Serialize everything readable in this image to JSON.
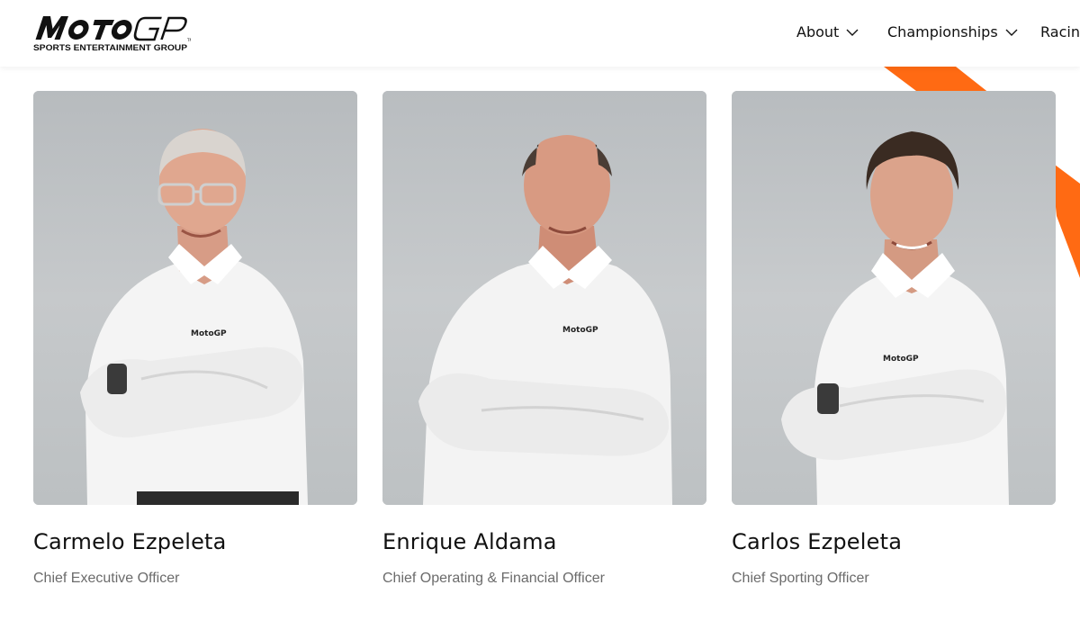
{
  "header": {
    "logo": {
      "wordmark": "MotoGP",
      "tagline": "SPORTS ENTERTAINMENT GROUP"
    },
    "nav": [
      {
        "label": "About",
        "icon": "chevron-down-icon"
      },
      {
        "label": "Championships",
        "icon": "chevron-down-icon"
      },
      {
        "label": "Racing"
      }
    ]
  },
  "colors": {
    "accent": "#ff6a13",
    "text": "#111111",
    "muted": "#6b6b6b",
    "photo_bg": "#c2c5c7"
  },
  "team": [
    {
      "name": "Carmelo Ezpeleta",
      "role": "Chief Executive Officer"
    },
    {
      "name": "Enrique Aldama",
      "role": "Chief Operating & Financial Officer"
    },
    {
      "name": "Carlos Ezpeleta",
      "role": "Chief Sporting Officer"
    }
  ]
}
